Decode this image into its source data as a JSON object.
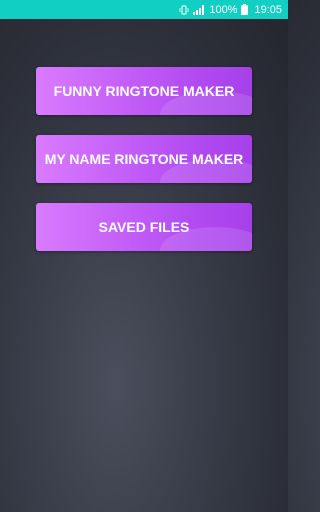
{
  "status_bar": {
    "battery": "100%",
    "time": "19:05",
    "icons": [
      "vibrate-icon",
      "signal-icon",
      "battery-icon"
    ]
  },
  "menu": {
    "funny_label": "FUNNY RINGTONE MAKER",
    "name_label": "MY NAME RINGTONE MAKER",
    "saved_label": "SAVED FILES"
  },
  "colors": {
    "status_bar": "#12cfc3",
    "button_start": "#d97bff",
    "button_end": "#a640ea",
    "background": "#2c2f39"
  }
}
